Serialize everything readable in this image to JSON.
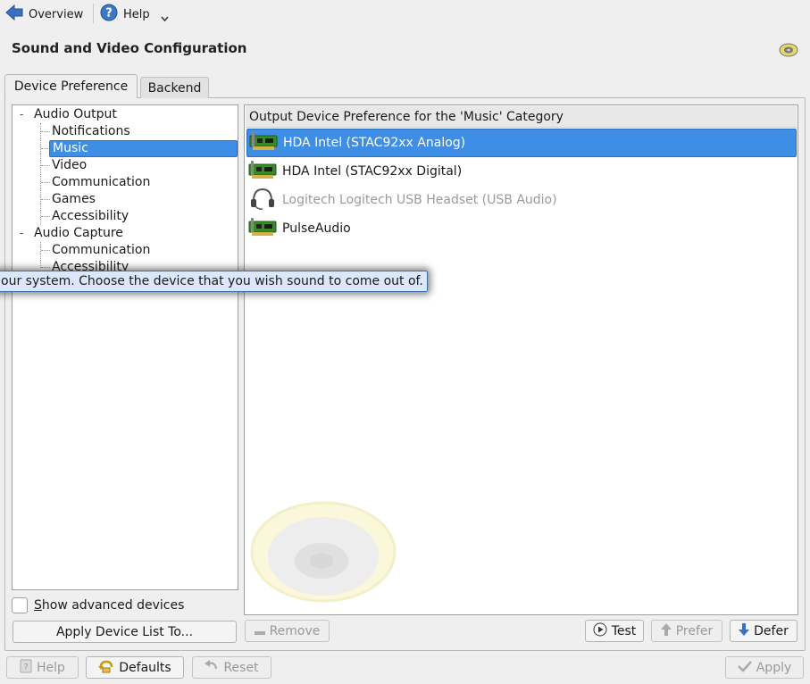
{
  "toolbar": {
    "overview_label": "Overview",
    "help_label": "Help",
    "help_menu_icon": "chevron-down-icon"
  },
  "page": {
    "title": "Sound and Video Configuration",
    "icon": "speaker-icon"
  },
  "tabs": [
    {
      "label": "Device Preference",
      "active": true
    },
    {
      "label": "Backend",
      "active": false
    }
  ],
  "tree": {
    "items": [
      {
        "label": "Audio Output",
        "level": 0
      },
      {
        "label": "Notifications",
        "level": 1
      },
      {
        "label": "Music",
        "level": 1,
        "selected": true
      },
      {
        "label": "Video",
        "level": 1
      },
      {
        "label": "Communication",
        "level": 1
      },
      {
        "label": "Games",
        "level": 1
      },
      {
        "label": "Accessibility",
        "level": 1
      },
      {
        "label": "Audio Capture",
        "level": 0
      },
      {
        "label": "Communication",
        "level": 1
      },
      {
        "label": "Accessibility",
        "level": 1
      }
    ]
  },
  "tooltip": {
    "text": "our system.  Choose the device that you wish sound to come out of."
  },
  "device_list": {
    "header": "Output Device Preference for the 'Music' Category",
    "devices": [
      {
        "label": "HDA Intel (STAC92xx Analog)",
        "icon": "sound-card-icon",
        "selected": true
      },
      {
        "label": "HDA Intel (STAC92xx Digital)",
        "icon": "sound-card-icon"
      },
      {
        "label": "Logitech Logitech USB Headset (USB Audio)",
        "icon": "headset-icon",
        "disabled": true
      },
      {
        "label": "PulseAudio",
        "icon": "sound-card-icon"
      }
    ]
  },
  "options": {
    "show_advanced_label": "Show advanced devices",
    "show_advanced_checked": false,
    "apply_list_label": "Apply Device List To..."
  },
  "list_buttons": {
    "remove": "Remove",
    "test": "Test",
    "prefer": "Prefer",
    "defer": "Defer"
  },
  "bottom_buttons": {
    "help": "Help",
    "defaults": "Defaults",
    "reset": "Reset",
    "apply": "Apply"
  },
  "colors": {
    "selection": "#3d8ee4",
    "tooltip_bg": "#dbe8fb",
    "card_green": "#3a8a2c"
  }
}
